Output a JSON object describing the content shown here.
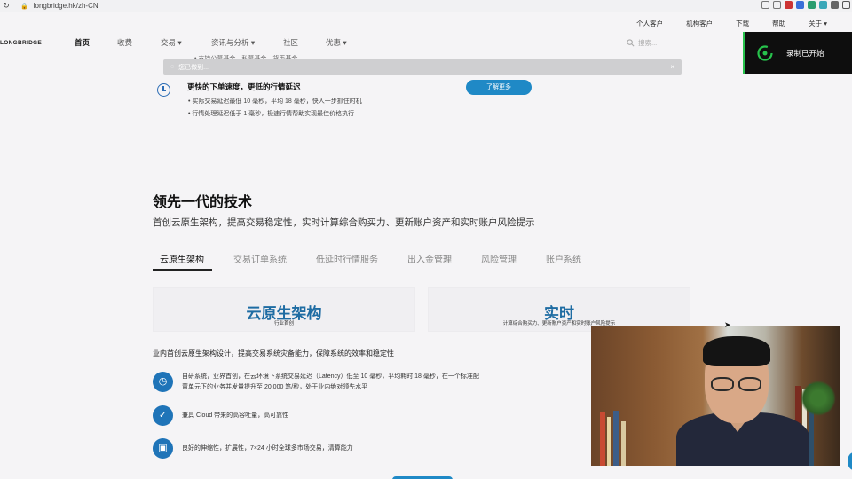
{
  "browser": {
    "url": "longbridge.hk/zh-CN",
    "reload_icon": "↻",
    "lock_icon": "🔒"
  },
  "header": {
    "utility_links": [
      "个人客户",
      "机构客户",
      "下载",
      "帮助",
      "关于 ▾"
    ],
    "logo": "LONGBRIDGE",
    "nav": [
      "首页",
      "收费",
      "交易 ▾",
      "资讯与分析 ▾",
      "社区",
      "优惠 ▾"
    ],
    "search_placeholder": "搜索..."
  },
  "recording_toast": {
    "text": "录制已开始",
    "accent": "#27c24c"
  },
  "notice": {
    "text": "您已做到...",
    "close": "×"
  },
  "top_partial": "• 支持公募基金、私募基金、货币基金",
  "feature_top": {
    "title": "更快的下单速度，更低的行情延迟",
    "bullets": [
      "• 实际交易延迟最低 10 毫秒，平均 18 毫秒，快人一步抓住时机",
      "• 行情处理延迟低于 1 毫秒，极速行情帮助实现最佳价格执行"
    ],
    "button": "了解更多"
  },
  "tech": {
    "title": "领先一代的技术",
    "subtitle": "首创云原生架构，提高交易稳定性，实时计算综合购买力、更新账户资产和实时账户风险提示",
    "tabs": [
      "云原生架构",
      "交易订单系统",
      "低延时行情服务",
      "出入金管理",
      "风险管理",
      "账户系统"
    ],
    "cards": [
      {
        "big": "云原生架构",
        "small": "行业首创"
      },
      {
        "big": "实时",
        "small": "计算综合购买力、更新账户资产和实时账户风险提示"
      }
    ],
    "intro": "业内首创云原生架构设计，提高交易系统灾备能力，保障系统的效率和稳定性",
    "features": [
      {
        "icon": "◷",
        "text": "自研系统，业界首创，在云环境下系统交易延迟（Latency）低至 10 毫秒，平均耗时 18 毫秒，在一个标准配置单元下的业务并发量提升至 20,000 笔/秒，处于业内绝对领先水平"
      },
      {
        "icon": "✓",
        "text": "兼具 Cloud 带来的高容吐量，高可靠性"
      },
      {
        "icon": "▣",
        "text": "良好的伸缩性，扩展性，7×24 小时全球多市场交易，清算能力"
      }
    ]
  },
  "colors": {
    "brand_blue": "#1f89c6",
    "heading_blue": "#1e6ca3"
  }
}
